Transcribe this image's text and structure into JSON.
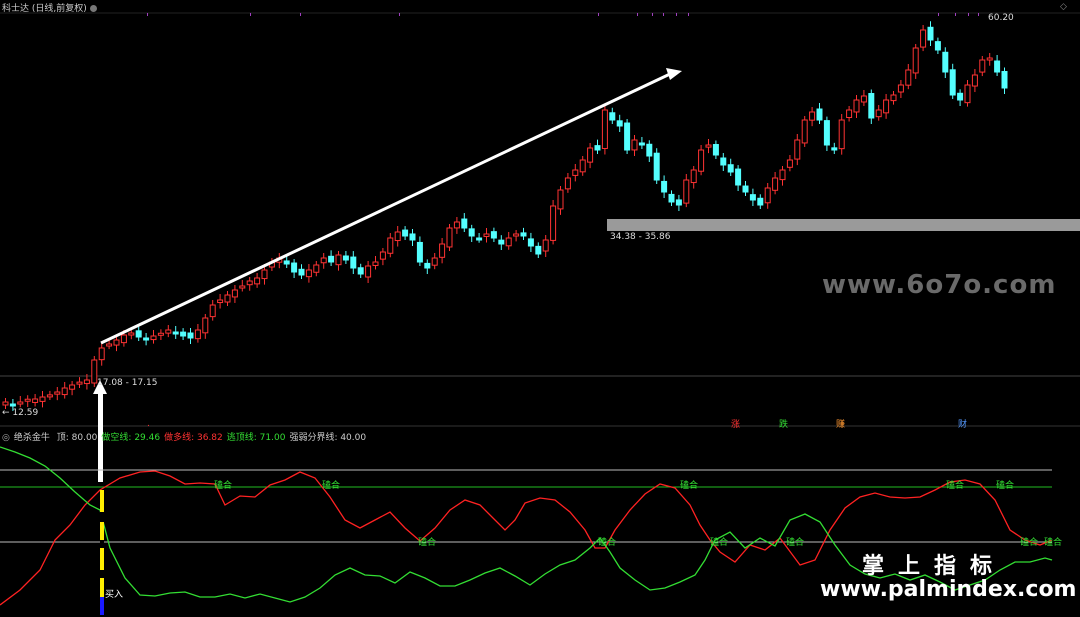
{
  "header": {
    "title": "科士达 (日线,前复权)"
  },
  "price_labels": {
    "high": "60.20",
    "low": "12.59",
    "zone_low": "17.08 - 17.15",
    "zone_high": "34.38 - 35.86"
  },
  "indicator": {
    "name": "绝杀金牛",
    "items": [
      {
        "label": "顶: 80.00",
        "color": "#cccccc"
      },
      {
        "label": "做空线: 29.46",
        "color": "#33dd33"
      },
      {
        "label": "做多线: 36.82",
        "color": "#ff3333"
      },
      {
        "label": "逃顶线: 71.00",
        "color": "#33dd33"
      },
      {
        "label": "强弱分界线: 40.00",
        "color": "#cccccc"
      }
    ],
    "buy_label": "买入",
    "cross_labels": [
      "磕合",
      "磕合",
      "磕合",
      "磕合",
      "磕合",
      "磕合",
      "磕合",
      "磕合",
      "磕合",
      "磕合",
      "磕合"
    ]
  },
  "signals": [
    "涨",
    "跌",
    "赚",
    "财"
  ],
  "watermarks": {
    "site1": "www.6o7o.com",
    "site2_cn": "掌上指标",
    "site2_url": "www.palmindex.com"
  },
  "colors": {
    "up": "#ff3333",
    "down": "#54ffff",
    "bull_line": "#ff2222",
    "bear_line": "#33dd33"
  }
}
